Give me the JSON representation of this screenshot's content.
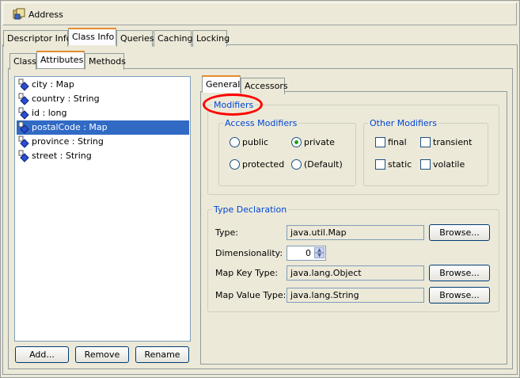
{
  "window": {
    "title": "Address",
    "title_icon": "class-icon"
  },
  "top_tabs": [
    "Descriptor Info",
    "Class Info",
    "Queries",
    "Caching",
    "Locking"
  ],
  "sub_tabs": [
    "Class",
    "Attributes",
    "Methods"
  ],
  "attributes": [
    {
      "label": "city : Map",
      "icon": "attribute-icon"
    },
    {
      "label": "country : String",
      "icon": "attribute-icon"
    },
    {
      "label": "id : long",
      "icon": "attribute-icon"
    },
    {
      "label": "postalCode : Map",
      "icon": "attribute-icon",
      "selected": true
    },
    {
      "label": "province : String",
      "icon": "attribute-icon"
    },
    {
      "label": "street : String",
      "icon": "attribute-icon"
    }
  ],
  "list_buttons": {
    "add": "Add...",
    "remove": "Remove",
    "rename": "Rename"
  },
  "detail_tabs": [
    "General",
    "Accessors"
  ],
  "modifiers": {
    "title": "Modifiers",
    "access": {
      "title": "Access Modifiers",
      "options": [
        "public",
        "private",
        "protected",
        "(Default)"
      ],
      "selected": "private"
    },
    "other": {
      "title": "Other Modifiers",
      "options": [
        {
          "label": "final",
          "checked": false
        },
        {
          "label": "transient",
          "checked": false
        },
        {
          "label": "static",
          "checked": false
        },
        {
          "label": "volatile",
          "checked": false
        }
      ]
    }
  },
  "type_declaration": {
    "title": "Type Declaration",
    "type_label": "Type:",
    "type_value": "java.util.Map",
    "dimensionality_label": "Dimensionality:",
    "dimensionality_value": "0",
    "map_key_label": "Map Key Type:",
    "map_key_value": "java.lang.Object",
    "map_value_label": "Map Value Type:",
    "map_value_value": "java.lang.String",
    "browse": "Browse..."
  },
  "colors": {
    "selection": "#316ac5",
    "legend": "#0046d5",
    "annotation": "#ff0000",
    "tab_highlight": "#e68b2c"
  }
}
